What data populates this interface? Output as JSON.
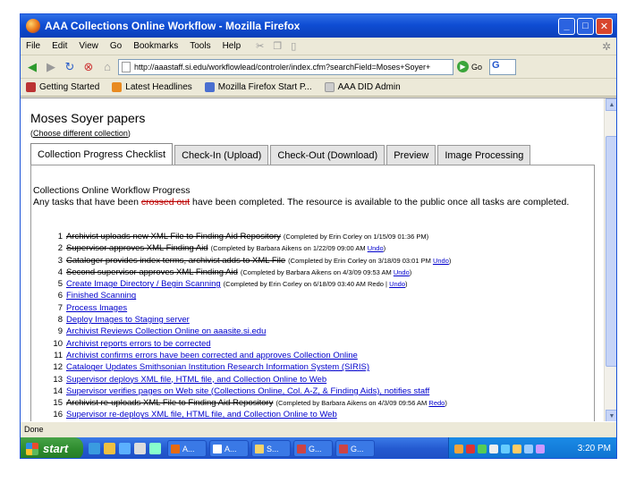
{
  "window": {
    "title": "AAA Collections Online Workflow - Mozilla Firefox"
  },
  "menu": [
    "File",
    "Edit",
    "View",
    "Go",
    "Bookmarks",
    "Tools",
    "Help"
  ],
  "nav": {
    "url": "http://aaastaff.si.edu/workflowlead/controler/index.cfm?searchField=Moses+Soyer+",
    "go_label": "Go",
    "search_letter": "G"
  },
  "bookmarks": [
    "Getting Started",
    "Latest Headlines",
    "Mozilla Firefox Start P...",
    "AAA DID Admin"
  ],
  "page": {
    "title": "Moses Soyer papers",
    "choose_prefix": "(",
    "choose_link": "Choose different collection",
    "choose_suffix": ")",
    "tabs": [
      "Collection Progress Checklist",
      "Check-In (Upload)",
      "Check-Out (Download)",
      "Preview",
      "Image Processing"
    ],
    "active_tab": 0,
    "progress_title": "Collections Online Workflow Progress",
    "desc_before": "Any tasks that have been ",
    "desc_strike": "crossed out",
    "desc_after": " have been completed. The resource is available to the public once all tasks are completed.",
    "tasks": [
      {
        "num": "1",
        "text": "Archivist uploads new XML File to Finding Aid Repository",
        "done": true,
        "note": "(Completed by Erin Corley on 1/15/09 01:36 PM",
        "link": "",
        "note_end": ")"
      },
      {
        "num": "2",
        "text": "Supervisor approves XML Finding Aid",
        "done": true,
        "note": "(Completed by Barbara Aikens on 1/22/09 09:00 AM",
        "link": "Undo",
        "note_end": ")"
      },
      {
        "num": "3",
        "text": "Cataloger provides index terms, archivist adds to XML File",
        "done": true,
        "note": "(Completed by Erin Corley on 3/18/09 03:01 PM",
        "link": "Undo",
        "note_end": ")"
      },
      {
        "num": "4",
        "text": "Second supervisor approves XML Finding Aid",
        "done": true,
        "note": "(Completed by Barbara Aikens on 4/3/09 09:53 AM",
        "link": "Undo",
        "note_end": ")"
      },
      {
        "num": "5",
        "text": "Create Image Directory / Begin Scanning",
        "done": false,
        "note": "(Completed by Erin Corley on 6/18/09 03:40 AM Redo |",
        "link": "Undo",
        "note_end": ")"
      },
      {
        "num": "6",
        "text": "Finished Scanning",
        "done": false,
        "note": "",
        "link": "",
        "note_end": ""
      },
      {
        "num": "7",
        "text": "Process Images",
        "done": false,
        "note": "",
        "link": "",
        "note_end": ""
      },
      {
        "num": "8",
        "text": "Deploy Images to Staging server",
        "done": false,
        "note": "",
        "link": "",
        "note_end": ""
      },
      {
        "num": "9",
        "text": "Archivist Reviews Collection Online on aaasite.si.edu",
        "done": false,
        "note": "",
        "link": "",
        "note_end": ""
      },
      {
        "num": "10",
        "text": "Archivist reports errors to be corrected",
        "done": false,
        "note": "",
        "link": "",
        "note_end": ""
      },
      {
        "num": "11",
        "text": "Archivist confirms errors have been corrected and approves Collection Online",
        "done": false,
        "note": "",
        "link": "",
        "note_end": ""
      },
      {
        "num": "12",
        "text": "Cataloger Updates Smithsonian Institution Research Information System (SIRIS)",
        "done": false,
        "note": "",
        "link": "",
        "note_end": ""
      },
      {
        "num": "13",
        "text": "Supervisor deploys XML file, HTML file, and Collection Online to Web",
        "done": false,
        "note": "",
        "link": "",
        "note_end": ""
      },
      {
        "num": "14",
        "text": "Supervisor verifies pages on Web site (Collections Online, Col. A-Z, & Finding Aids), notifies staff",
        "done": false,
        "note": "",
        "link": "",
        "note_end": ""
      },
      {
        "num": "15",
        "text": "Archivist re-uploads XML File to Finding Aid Repository",
        "done": true,
        "note": "(Completed by Barbara Aikens on 4/3/09 09:56 AM",
        "link": "Redo",
        "note_end": ")"
      },
      {
        "num": "16",
        "text": "Supervisor re-deploys XML file, HTML file, and Collection Online to Web",
        "done": false,
        "note": "",
        "link": "",
        "note_end": ""
      }
    ]
  },
  "status": "Done",
  "taskbar": {
    "start": "start",
    "buttons": [
      "A...",
      "A...",
      "S...",
      "G...",
      "G..."
    ],
    "clock": "3:20 PM"
  },
  "colors": {
    "link": "#0000cc",
    "titlebar": "#0f4dd4",
    "start": "#2d8b2d"
  }
}
